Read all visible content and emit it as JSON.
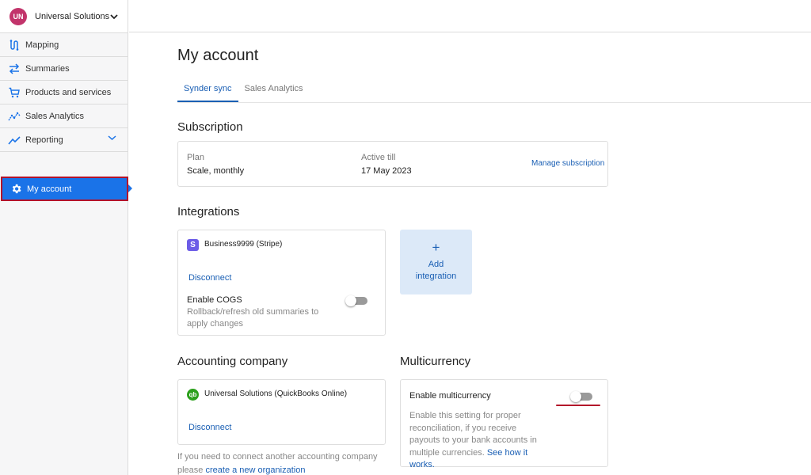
{
  "org": {
    "initials": "UN",
    "name": "Universal Solutions"
  },
  "sidebar": {
    "items": [
      {
        "label": "Mapping",
        "icon": "mapping-icon"
      },
      {
        "label": "Summaries",
        "icon": "swap-arrows-icon"
      },
      {
        "label": "Products and services",
        "icon": "cart-icon"
      },
      {
        "label": "Sales Analytics",
        "icon": "analytics-icon"
      },
      {
        "label": "Reporting",
        "icon": "trend-icon"
      }
    ],
    "active": {
      "label": "My account",
      "icon": "gear-icon"
    }
  },
  "colors": {
    "accent": "#1a73e8",
    "link": "#1a5fb4",
    "highlight": "#b3122a",
    "avatar": "#c2346b"
  },
  "page": {
    "title": "My account",
    "tabs": [
      {
        "label": "Synder sync",
        "active": true
      },
      {
        "label": "Sales Analytics",
        "active": false
      }
    ]
  },
  "subscription": {
    "title": "Subscription",
    "plan_label": "Plan",
    "plan_value": "Scale, monthly",
    "active_label": "Active till",
    "active_value": "17 May 2023",
    "manage_link": "Manage subscription"
  },
  "integrations": {
    "title": "Integrations",
    "card": {
      "badge": "S",
      "name": "Business9999 (Stripe)",
      "disconnect": "Disconnect",
      "cogs_label": "Enable COGS",
      "cogs_note": "Rollback/refresh old summaries to apply changes",
      "cogs_enabled": false
    },
    "add": {
      "plus": "+",
      "label": "Add integration"
    }
  },
  "accounting": {
    "title": "Accounting company",
    "badge": "qb",
    "name": "Universal Solutions (QuickBooks Online)",
    "disconnect": "Disconnect",
    "note_prefix": "If you need to connect another accounting company please",
    "note_link": "create a new organization"
  },
  "multicurrency": {
    "title": "Multicurrency",
    "label": "Enable multicurrency",
    "enabled": false,
    "note": "Enable this setting for proper reconciliation, if you receive payouts to your bank accounts in multiple currencies.",
    "note_link": "See how it works."
  }
}
